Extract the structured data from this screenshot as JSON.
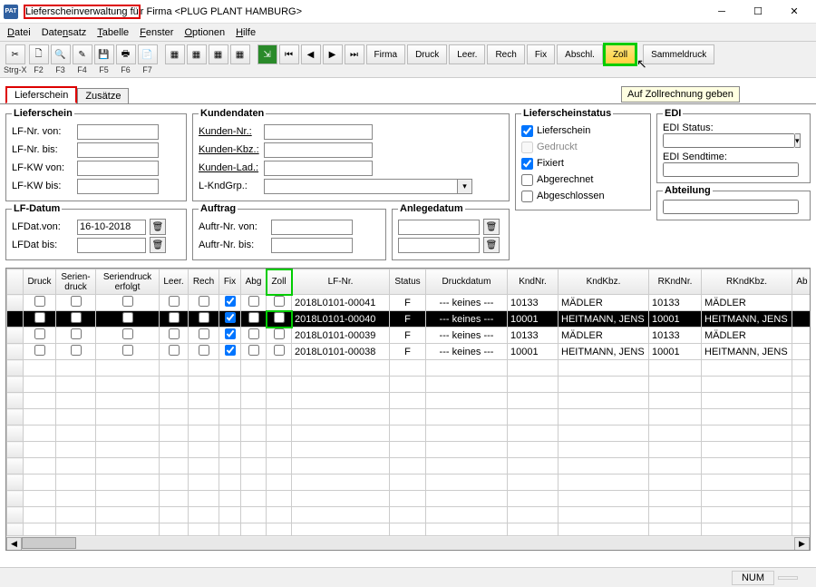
{
  "window": {
    "title_prefix": "Lieferscheinverwaltung fü",
    "title_suffix": "r Firma <PLUG PLANT HAMBURG>",
    "icon_text": "PAT"
  },
  "menu": [
    "Datei",
    "Datensatz",
    "Tabelle",
    "Fenster",
    "Optionen",
    "Hilfe"
  ],
  "toolbar": {
    "shortcuts": [
      "Strg-X",
      "F2",
      "F3",
      "F4",
      "F5",
      "F6",
      "F7"
    ],
    "text_buttons": [
      "Firma",
      "Druck",
      "Leer.",
      "Rech",
      "Fix",
      "Abschl.",
      "Zoll",
      "Sammeldruck"
    ],
    "tooltip": "Auf Zollrechnung geben"
  },
  "tabs": {
    "active": "Lieferschein",
    "other": "Zusätze"
  },
  "fieldsets": {
    "lieferschein": {
      "legend": "Lieferschein",
      "lf_nr_von": "LF-Nr. von:",
      "lf_nr_bis": "LF-Nr. bis:",
      "lf_kw_von": "LF-KW von:",
      "lf_kw_bis": "LF-KW bis:"
    },
    "lfdatum": {
      "legend": "LF-Datum",
      "von": "LFDat.von:",
      "von_val": "16-10-2018",
      "bis": "LFDat bis:"
    },
    "kundendaten": {
      "legend": "Kundendaten",
      "knr": "Kunden-Nr.:",
      "kkz": "Kunden-Kbz.:",
      "klad": "Kunden-Lad.:",
      "lkg": "L-KndGrp.:"
    },
    "auftrag": {
      "legend": "Auftrag",
      "von": "Auftr-Nr. von:",
      "bis": "Auftr-Nr. bis:"
    },
    "anlegedatum": {
      "legend": "Anlegedatum"
    },
    "status": {
      "legend": "Lieferscheinstatus",
      "lieferschein": "Lieferschein",
      "gedruckt": "Gedruckt",
      "fixiert": "Fixiert",
      "abgerechnet": "Abgerechnet",
      "abgeschlossen": "Abgeschlossen"
    },
    "edi": {
      "legend": "EDI",
      "status": "EDI Status:",
      "sendtime": "EDI Sendtime:"
    },
    "abteilung": {
      "legend": "Abteilung"
    }
  },
  "grid": {
    "headers": [
      "",
      "Druck",
      "Serien-\ndruck",
      "Seriendruck\nerfolgt",
      "Leer.",
      "Rech",
      "Fix",
      "Abg",
      "Zoll",
      "LF-Nr.",
      "Status",
      "Druckdatum",
      "KndNr.",
      "KndKbz.",
      "RKndNr.",
      "RKndKbz.",
      "Ab"
    ],
    "rows": [
      {
        "sel": false,
        "chk": [
          false,
          false,
          false,
          false,
          false,
          true,
          false,
          false
        ],
        "lfnr": "2018L0101-00041",
        "status": "F",
        "druckdatum": "--- keines ---",
        "kndnr": "10133",
        "kndkbz": "MÄDLER",
        "rkndnr": "10133",
        "rkndkbz": "MÄDLER"
      },
      {
        "sel": true,
        "chk": [
          false,
          false,
          false,
          false,
          false,
          true,
          false,
          false
        ],
        "lfnr": "2018L0101-00040",
        "status": "F",
        "druckdatum": "--- keines ---",
        "kndnr": "10001",
        "kndkbz": "HEITMANN, JENS",
        "rkndnr": "10001",
        "rkndkbz": "HEITMANN, JENS"
      },
      {
        "sel": false,
        "chk": [
          false,
          false,
          false,
          false,
          false,
          true,
          false,
          false
        ],
        "lfnr": "2018L0101-00039",
        "status": "F",
        "druckdatum": "--- keines ---",
        "kndnr": "10133",
        "kndkbz": "MÄDLER",
        "rkndnr": "10133",
        "rkndkbz": "MÄDLER"
      },
      {
        "sel": false,
        "chk": [
          false,
          false,
          false,
          false,
          false,
          true,
          false,
          false
        ],
        "lfnr": "2018L0101-00038",
        "status": "F",
        "druckdatum": "--- keines ---",
        "kndnr": "10001",
        "kndkbz": "HEITMANN, JENS",
        "rkndnr": "10001",
        "rkndkbz": "HEITMANN, JENS"
      }
    ]
  },
  "statusbar": {
    "num": "NUM"
  }
}
